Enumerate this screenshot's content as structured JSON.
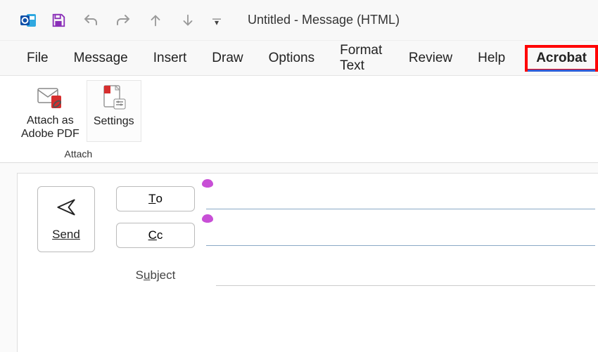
{
  "titlebar": {
    "title": "Untitled  -  Message (HTML)"
  },
  "tabs": {
    "file": "File",
    "message": "Message",
    "insert": "Insert",
    "draw": "Draw",
    "options": "Options",
    "format_text": "Format Text",
    "review": "Review",
    "help": "Help",
    "acrobat": "Acrobat"
  },
  "ribbon": {
    "attach_group_label": "Attach",
    "attach_as_pdf_line1": "Attach as",
    "attach_as_pdf_line2": "Adobe PDF",
    "settings": "Settings"
  },
  "compose": {
    "send": "Send",
    "to": "To",
    "cc": "Cc",
    "subject": "Subject"
  }
}
